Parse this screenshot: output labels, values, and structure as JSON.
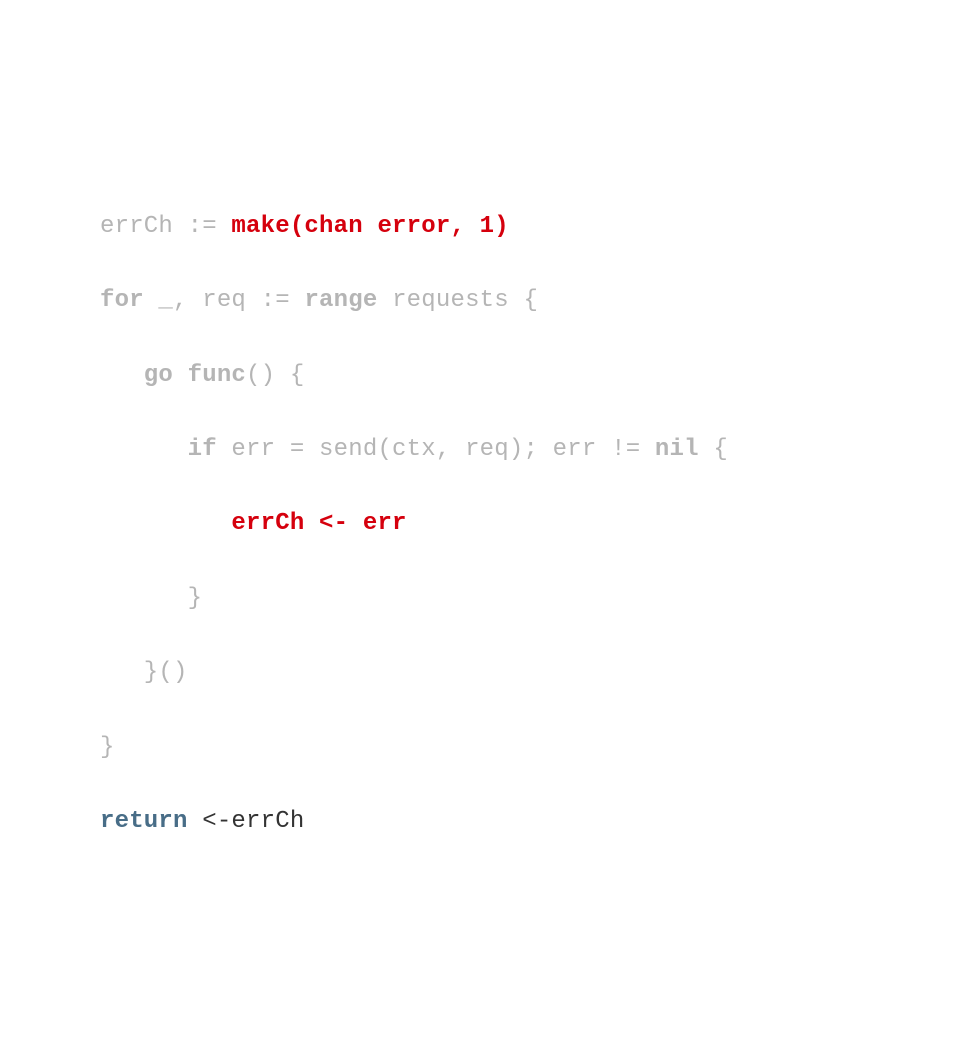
{
  "code": {
    "l1a": "errCh := ",
    "l1b": "make(chan error, 1)",
    "l2a": "for",
    "l2b": " _, req := ",
    "l2c": "range",
    "l2d": " requests {",
    "l3a": "   go func",
    "l3b": "() {",
    "l4a": "      if",
    "l4b": " err = send(ctx, req); err != ",
    "l4c": "nil",
    "l4d": " {",
    "l5": "         errCh <- err",
    "l6": "      }",
    "l7": "   }()",
    "l8": "}",
    "l9a": "return",
    "l9b": " <-errCh"
  }
}
